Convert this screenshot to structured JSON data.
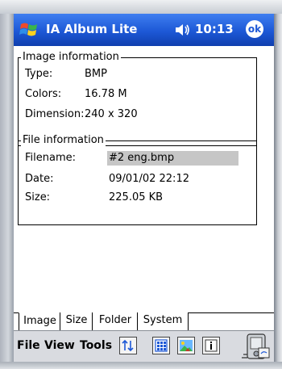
{
  "app": {
    "title": "IA Album Lite",
    "time": "10:13",
    "ok_label": "ok"
  },
  "image_info": {
    "group_title": "Image information",
    "rows": [
      {
        "label": "Type:",
        "value": "BMP"
      },
      {
        "label": "Colors:",
        "value": "16.78 M"
      },
      {
        "label": "Dimension:",
        "value": "240 x 320"
      }
    ]
  },
  "file_info": {
    "group_title": "File information",
    "rows": [
      {
        "label": "Filename:",
        "value": "#2 eng.bmp"
      },
      {
        "label": "Date:",
        "value": "09/01/02 22:12"
      },
      {
        "label": "Size:",
        "value": "225.05 KB"
      }
    ]
  },
  "tabs": [
    {
      "label": "Image",
      "active": true
    },
    {
      "label": "Size",
      "active": false
    },
    {
      "label": "Folder",
      "active": false
    },
    {
      "label": "System",
      "active": false
    }
  ],
  "menu": {
    "items": [
      "File",
      "View",
      "Tools"
    ]
  },
  "toolbar": {
    "icons": [
      "sort-icon",
      "thumbnail-grid-icon",
      "picture-icon",
      "info-icon"
    ]
  },
  "colors": {
    "titlebar": "#1d58d6",
    "selection_gray": "#c6c6c6"
  }
}
